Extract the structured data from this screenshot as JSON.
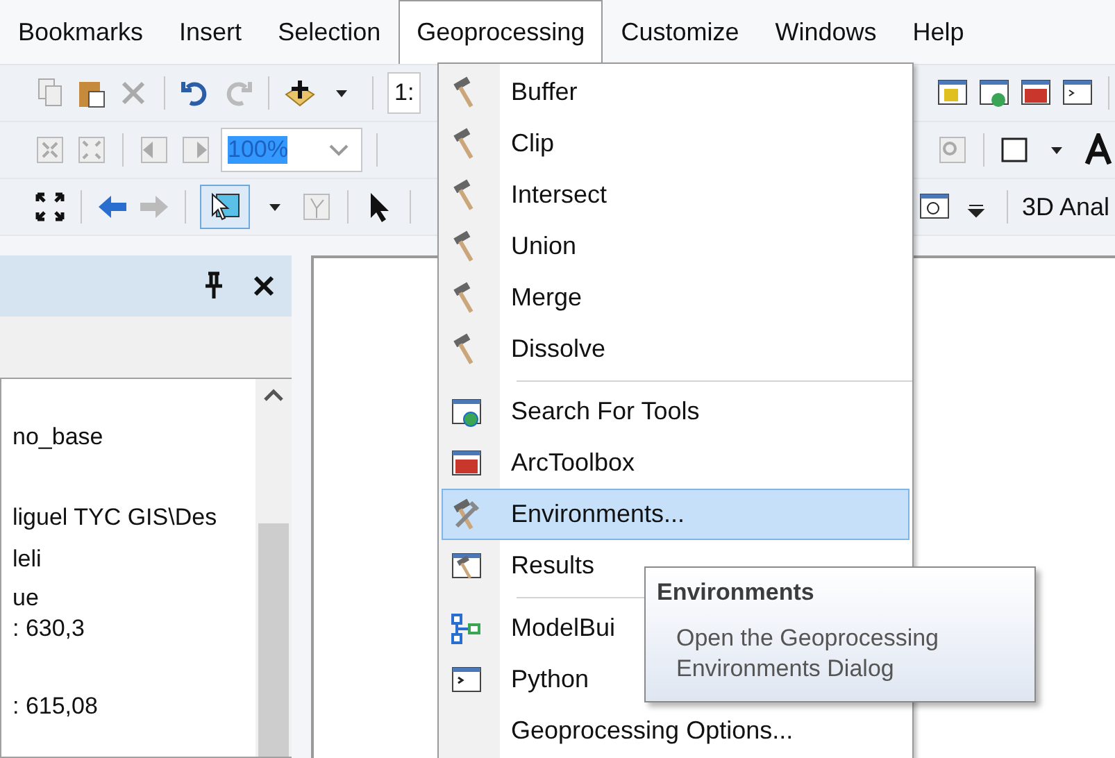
{
  "menubar": [
    {
      "label": "Bookmarks",
      "selected": false
    },
    {
      "label": "Insert",
      "selected": false
    },
    {
      "label": "Selection",
      "selected": false
    },
    {
      "label": "Geoprocessing",
      "selected": true
    },
    {
      "label": "Customize",
      "selected": false
    },
    {
      "label": "Windows",
      "selected": false
    },
    {
      "label": "Help",
      "selected": false
    }
  ],
  "toolbars": {
    "scale_field": {
      "value": "1:"
    },
    "zoom_field": {
      "value": "100%",
      "selected": true
    },
    "toolbar_label": "3D Anal"
  },
  "panel": {
    "lines": [
      "no_base",
      "liguel TYC GIS\\Des",
      "leli",
      "ue",
      ": 630,3",
      ": 615,08"
    ]
  },
  "menu": {
    "groups": [
      [
        {
          "label": "Buffer",
          "selected": false
        },
        {
          "label": "Clip",
          "selected": false
        },
        {
          "label": "Intersect",
          "selected": false
        },
        {
          "label": "Union",
          "selected": false
        },
        {
          "label": "Merge",
          "selected": false
        },
        {
          "label": "Dissolve",
          "selected": false
        }
      ],
      [
        {
          "label": "Search For Tools",
          "selected": false
        },
        {
          "label": "ArcToolbox",
          "selected": false
        },
        {
          "label": "Environments...",
          "selected": true
        },
        {
          "label": "Results",
          "selected": false
        }
      ],
      [
        {
          "label": "ModelBui",
          "selected": false
        },
        {
          "label": "Python",
          "selected": false
        },
        {
          "label": "Geoprocessing Options...",
          "selected": false
        }
      ]
    ]
  },
  "tooltip": {
    "title": "Environments",
    "description": "Open the Geoprocessing Environments Dialog"
  }
}
